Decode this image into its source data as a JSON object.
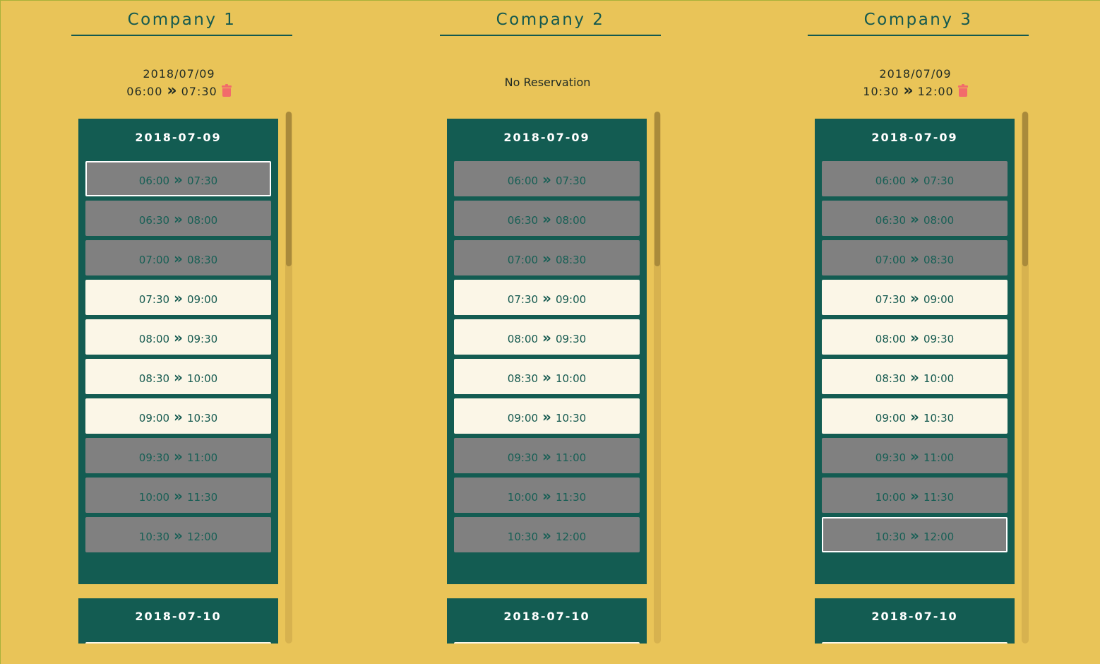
{
  "companies": [
    {
      "name": "Company 1",
      "reservation": {
        "date": "2018/07/09",
        "start": "06:00",
        "end": "07:30"
      },
      "days": [
        {
          "date": "2018-07-09",
          "slots": [
            {
              "start": "06:00",
              "end": "07:30",
              "status": "unavailable",
              "selected": true
            },
            {
              "start": "06:30",
              "end": "08:00",
              "status": "unavailable",
              "selected": false
            },
            {
              "start": "07:00",
              "end": "08:30",
              "status": "unavailable",
              "selected": false
            },
            {
              "start": "07:30",
              "end": "09:00",
              "status": "available",
              "selected": false
            },
            {
              "start": "08:00",
              "end": "09:30",
              "status": "available",
              "selected": false
            },
            {
              "start": "08:30",
              "end": "10:00",
              "status": "available",
              "selected": false
            },
            {
              "start": "09:00",
              "end": "10:30",
              "status": "available",
              "selected": false
            },
            {
              "start": "09:30",
              "end": "11:00",
              "status": "unavailable",
              "selected": false
            },
            {
              "start": "10:00",
              "end": "11:30",
              "status": "unavailable",
              "selected": false
            },
            {
              "start": "10:30",
              "end": "12:00",
              "status": "unavailable",
              "selected": false
            }
          ]
        },
        {
          "date": "2018-07-10",
          "slots": []
        }
      ]
    },
    {
      "name": "Company 2",
      "reservation": null,
      "no_reservation_text": "No Reservation",
      "days": [
        {
          "date": "2018-07-09",
          "slots": [
            {
              "start": "06:00",
              "end": "07:30",
              "status": "unavailable",
              "selected": false
            },
            {
              "start": "06:30",
              "end": "08:00",
              "status": "unavailable",
              "selected": false
            },
            {
              "start": "07:00",
              "end": "08:30",
              "status": "unavailable",
              "selected": false
            },
            {
              "start": "07:30",
              "end": "09:00",
              "status": "available",
              "selected": false
            },
            {
              "start": "08:00",
              "end": "09:30",
              "status": "available",
              "selected": false
            },
            {
              "start": "08:30",
              "end": "10:00",
              "status": "available",
              "selected": false
            },
            {
              "start": "09:00",
              "end": "10:30",
              "status": "available",
              "selected": false
            },
            {
              "start": "09:30",
              "end": "11:00",
              "status": "unavailable",
              "selected": false
            },
            {
              "start": "10:00",
              "end": "11:30",
              "status": "unavailable",
              "selected": false
            },
            {
              "start": "10:30",
              "end": "12:00",
              "status": "unavailable",
              "selected": false
            }
          ]
        },
        {
          "date": "2018-07-10",
          "slots": []
        }
      ]
    },
    {
      "name": "Company 3",
      "reservation": {
        "date": "2018/07/09",
        "start": "10:30",
        "end": "12:00"
      },
      "days": [
        {
          "date": "2018-07-09",
          "slots": [
            {
              "start": "06:00",
              "end": "07:30",
              "status": "unavailable",
              "selected": false
            },
            {
              "start": "06:30",
              "end": "08:00",
              "status": "unavailable",
              "selected": false
            },
            {
              "start": "07:00",
              "end": "08:30",
              "status": "unavailable",
              "selected": false
            },
            {
              "start": "07:30",
              "end": "09:00",
              "status": "available",
              "selected": false
            },
            {
              "start": "08:00",
              "end": "09:30",
              "status": "available",
              "selected": false
            },
            {
              "start": "08:30",
              "end": "10:00",
              "status": "available",
              "selected": false
            },
            {
              "start": "09:00",
              "end": "10:30",
              "status": "available",
              "selected": false
            },
            {
              "start": "09:30",
              "end": "11:00",
              "status": "unavailable",
              "selected": false
            },
            {
              "start": "10:00",
              "end": "11:30",
              "status": "unavailable",
              "selected": false
            },
            {
              "start": "10:30",
              "end": "12:00",
              "status": "unavailable",
              "selected": true
            }
          ]
        },
        {
          "date": "2018-07-10",
          "slots": []
        }
      ]
    }
  ],
  "icons": {
    "delete": "trash-icon",
    "range_separator": "double-chevron-right-icon"
  },
  "colors": {
    "background": "#e9c458",
    "card": "#135c52",
    "slot_available": "#fbf6e7",
    "slot_unavailable": "#808080",
    "delete_icon": "#f26b6b"
  }
}
